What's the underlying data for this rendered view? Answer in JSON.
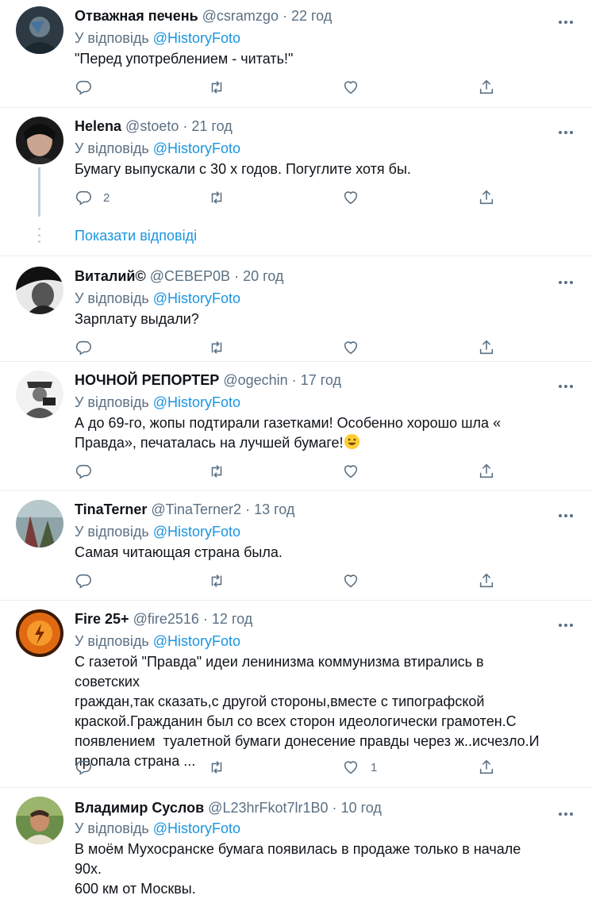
{
  "reply_prefix": "У відповідь",
  "show_replies_label": "Показати відповіді",
  "tweets": [
    {
      "name": "Отважная печень",
      "handle": "@csramzgo",
      "sep": "·",
      "time": "22 год",
      "mention": "@HistoryFoto",
      "text": "\"Перед употреблением - читать!\"",
      "reply_count": "",
      "like_count": ""
    },
    {
      "name": "Helena",
      "handle": "@stoeto",
      "sep": "·",
      "time": "21 год",
      "mention": "@HistoryFoto",
      "text": "Бумагу выпускали с 30 х годов. Погуглите хотя бы.",
      "reply_count": "2",
      "like_count": ""
    },
    {
      "name": "Виталий©",
      "handle": "@СЕВЕР0В",
      "sep": "·",
      "time": "20 год",
      "mention": "@HistoryFoto",
      "text": "Зарплату выдали?",
      "reply_count": "",
      "like_count": ""
    },
    {
      "name": "НОЧНОЙ РЕПОРТЕР",
      "handle": "@ogechin",
      "sep": "·",
      "time": "17 год",
      "mention": "@HistoryFoto",
      "text_lines": [
        "А до 69-го, жопы подтирали газетками! Особенно хорошо шла «",
        "Правда», печаталась на лучшей бумаге!"
      ],
      "reply_count": "",
      "like_count": ""
    },
    {
      "name": "TinaTerner",
      "handle": "@TinaTerner2",
      "sep": "·",
      "time": "13 год",
      "mention": "@HistoryFoto",
      "text": "Самая читающая страна была.",
      "reply_count": "",
      "like_count": ""
    },
    {
      "name": "Fire 25+",
      "handle": "@fire2516",
      "sep": "·",
      "time": "12 год",
      "mention": "@HistoryFoto",
      "text_lines": [
        "С газетой \"Правда\" идеи ленинизма коммунизма втирались в советских",
        "граждан,так сказать,с другой стороны,вместе с типографской",
        "краской.Гражданин был со всех сторон идеологически грамотен.С",
        "появлением  туалетной бумаги донесение правды через ж..исчезло.И",
        "пропала страна ..."
      ],
      "reply_count": "",
      "like_count": "1"
    },
    {
      "name": "Владимир Суслов",
      "handle": "@L23hrFkot7lr1B0",
      "sep": "·",
      "time": "10 год",
      "mention": "@HistoryFoto",
      "text_lines": [
        "В моём Мухосранске бумага появилась в продаже только в начале 90х.",
        "600 км от Москвы."
      ],
      "reply_count": "",
      "like_count": ""
    }
  ],
  "colors": {
    "accent": "#1b95e0",
    "muted": "#5b7083",
    "divider": "#ebeef0",
    "text": "#0f1419"
  },
  "icons": [
    "reply-icon",
    "retweet-icon",
    "like-icon",
    "share-icon",
    "more-icon",
    "grinning-emoji-icon"
  ]
}
